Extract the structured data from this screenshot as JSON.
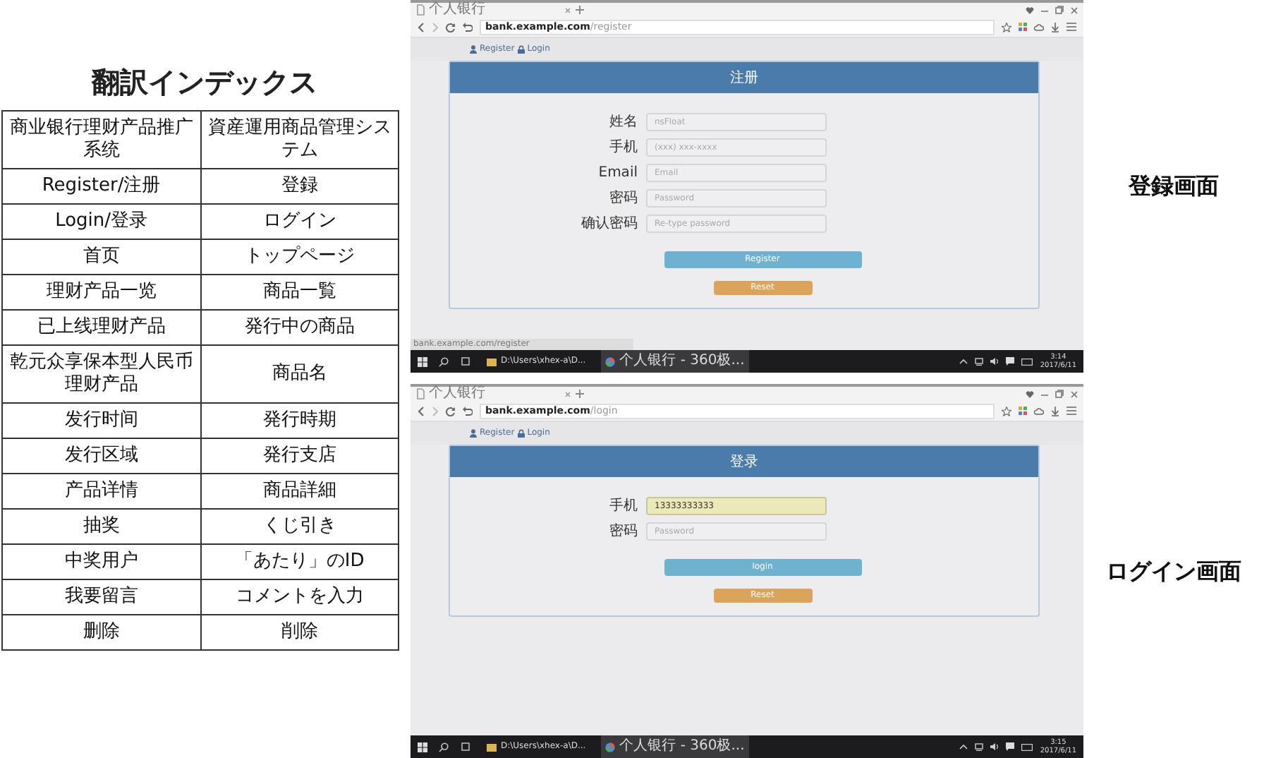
{
  "index_title": "翻訳インデックス",
  "index_rows": [
    [
      "商业银行理财产品推广系统",
      "資産運用商品管理システム"
    ],
    [
      "Register/注册",
      "登録"
    ],
    [
      "Login/登录",
      "ログイン"
    ],
    [
      "首页",
      "トップページ"
    ],
    [
      "理财产品一览",
      "商品一覧"
    ],
    [
      "已上线理财产品",
      "発行中の商品"
    ],
    [
      "乾元众享保本型人民币理财产品",
      "商品名"
    ],
    [
      "发行时间",
      "発行時期"
    ],
    [
      "发行区域",
      "発行支店"
    ],
    [
      "产品详情",
      "商品詳細"
    ],
    [
      "抽奖",
      "くじ引き"
    ],
    [
      "中奖用户",
      "「あたり」のID"
    ],
    [
      "我要留言",
      "コメントを入力"
    ],
    [
      "删除",
      "削除"
    ]
  ],
  "screens": [
    {
      "caption": "登録画面",
      "tab_title": "个人银行",
      "url_host": "bank.example.com",
      "url_path": "/register",
      "nav_links": [
        "Register",
        "Login"
      ],
      "panel_title": "注册",
      "fields": [
        {
          "label": "姓名",
          "placeholder": "nsFloat",
          "highlighted": false
        },
        {
          "label": "手机",
          "placeholder": "(xxx) xxx-xxxx",
          "highlighted": false
        },
        {
          "label": "Email",
          "placeholder": "Email",
          "highlighted": false
        },
        {
          "label": "密码",
          "placeholder": "Password",
          "highlighted": false
        },
        {
          "label": "确认密码",
          "placeholder": "Re-type password",
          "highlighted": false
        }
      ],
      "buttons": [
        {
          "label": "Register",
          "kind": "primary"
        },
        {
          "label": "Reset",
          "kind": "reset"
        }
      ],
      "status_bar": "bank.example.com/register",
      "taskbar": {
        "items": [
          "D:\\Users\\xhex-a\\D...",
          "个人银行 - 360极..."
        ],
        "time": "3:14",
        "date": "2017/6/11"
      }
    },
    {
      "caption": "ログイン画面",
      "tab_title": "个人银行",
      "url_host": "bank.example.com",
      "url_path": "/login",
      "nav_links": [
        "Register",
        "Login"
      ],
      "panel_title": "登录",
      "fields": [
        {
          "label": "手机",
          "value": "13333333333",
          "highlighted": true
        },
        {
          "label": "密码",
          "placeholder": "Password",
          "highlighted": false
        }
      ],
      "buttons": [
        {
          "label": "login",
          "kind": "primary"
        },
        {
          "label": "Reset",
          "kind": "reset"
        }
      ],
      "taskbar": {
        "items": [
          "D:\\Users\\xhex-a\\D...",
          "个人银行 - 360极..."
        ],
        "time": "3:15",
        "date": "2017/6/11"
      }
    }
  ]
}
